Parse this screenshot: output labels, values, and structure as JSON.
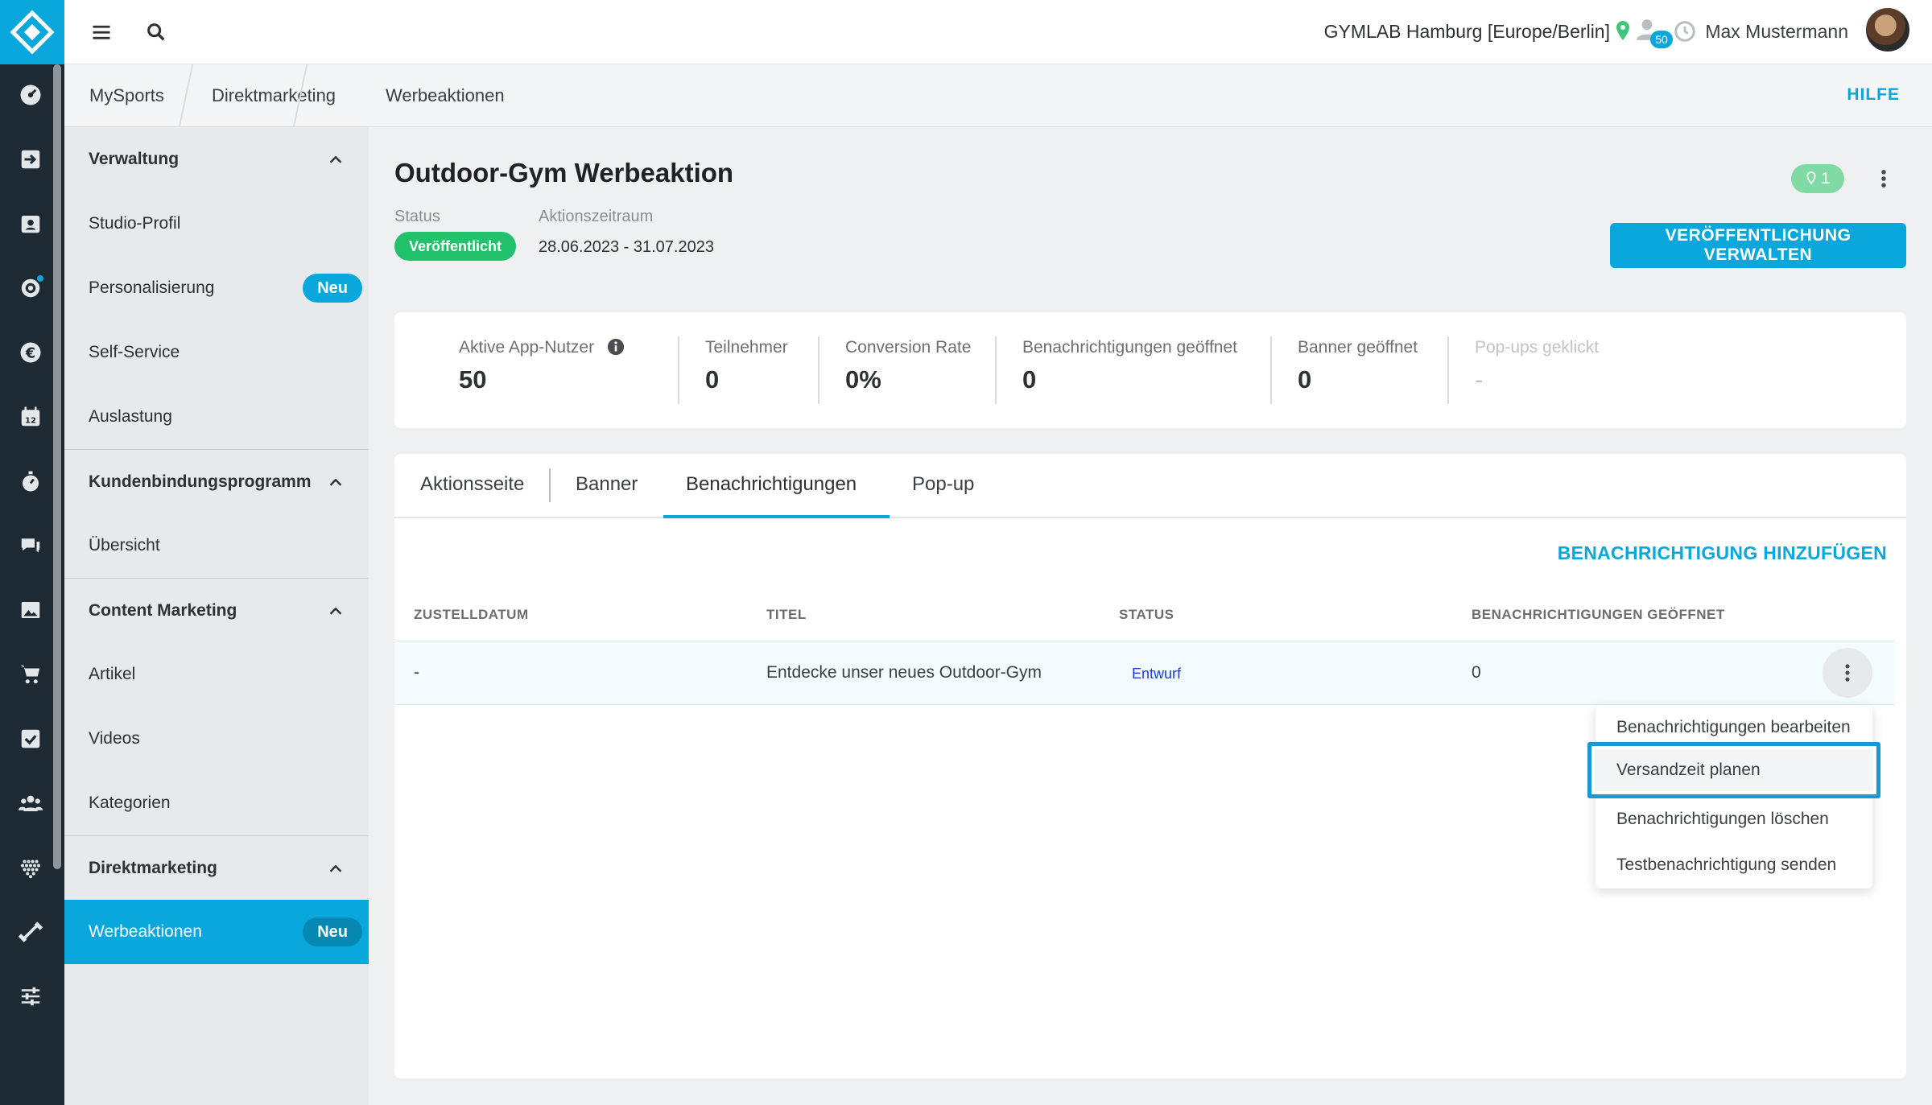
{
  "topbar": {
    "location": "GYMLAB Hamburg [Europe/Berlin]",
    "notification_count": "50",
    "user_name": "Max Mustermann"
  },
  "breadcrumb": {
    "items": [
      "MySports",
      "Direktmarketing",
      "Werbeaktionen"
    ],
    "help": "HILFE"
  },
  "sidebar": {
    "groups": [
      {
        "label": "Verwaltung",
        "items": [
          "Studio-Profil",
          "Personalisierung",
          "Self-Service",
          "Auslastung"
        ]
      },
      {
        "label": "Kundenbindungsprogramm",
        "items": [
          "Übersicht"
        ]
      },
      {
        "label": "Content Marketing",
        "items": [
          "Artikel",
          "Videos",
          "Kategorien"
        ]
      },
      {
        "label": "Direktmarketing",
        "items": [
          "Werbeaktionen"
        ]
      }
    ],
    "badge_new": "Neu",
    "active_item": "Werbeaktionen"
  },
  "campaign": {
    "title": "Outdoor-Gym Werbeaktion",
    "status_label": "Status",
    "status_value": "Veröffentlicht",
    "period_label": "Aktionszeitraum",
    "period_value": "28.06.2023 - 31.07.2023",
    "location_count": "1",
    "manage_button": "VERÖFFENTLICHUNG VERWALTEN"
  },
  "stats": [
    {
      "label": "Aktive App-Nutzer",
      "value": "50"
    },
    {
      "label": "Teilnehmer",
      "value": "0"
    },
    {
      "label": "Conversion Rate",
      "value": "0%"
    },
    {
      "label": "Benachrichtigungen geöffnet",
      "value": "0"
    },
    {
      "label": "Banner geöffnet",
      "value": "0"
    },
    {
      "label": "Pop-ups geklickt",
      "value": "-"
    }
  ],
  "tabs": [
    "Aktionsseite",
    "Banner",
    "Benachrichtigungen",
    "Pop-up"
  ],
  "active_tab": "Benachrichtigungen",
  "add_notification": "BENACHRICHTIGUNG HINZUFÜGEN",
  "table": {
    "headers": [
      "ZUSTELLDATUM",
      "TITEL",
      "STATUS",
      "BENACHRICHTIGUNGEN GEÖFFNET"
    ],
    "rows": [
      {
        "date": "-",
        "title": "Entdecke unser neues Outdoor-Gym",
        "status": "Entwurf",
        "opened": "0"
      }
    ]
  },
  "context_menu": {
    "items": [
      "Benachrichtigungen bearbeiten",
      "Versandzeit planen",
      "Benachrichtigungen löschen",
      "Testbenachrichtigung senden"
    ],
    "highlighted": "Versandzeit planen"
  },
  "colors": {
    "accent": "#0aa7dc",
    "rail": "#1e2a33",
    "status_green": "#21c26b",
    "draft_blue": "#1a3fd1"
  }
}
